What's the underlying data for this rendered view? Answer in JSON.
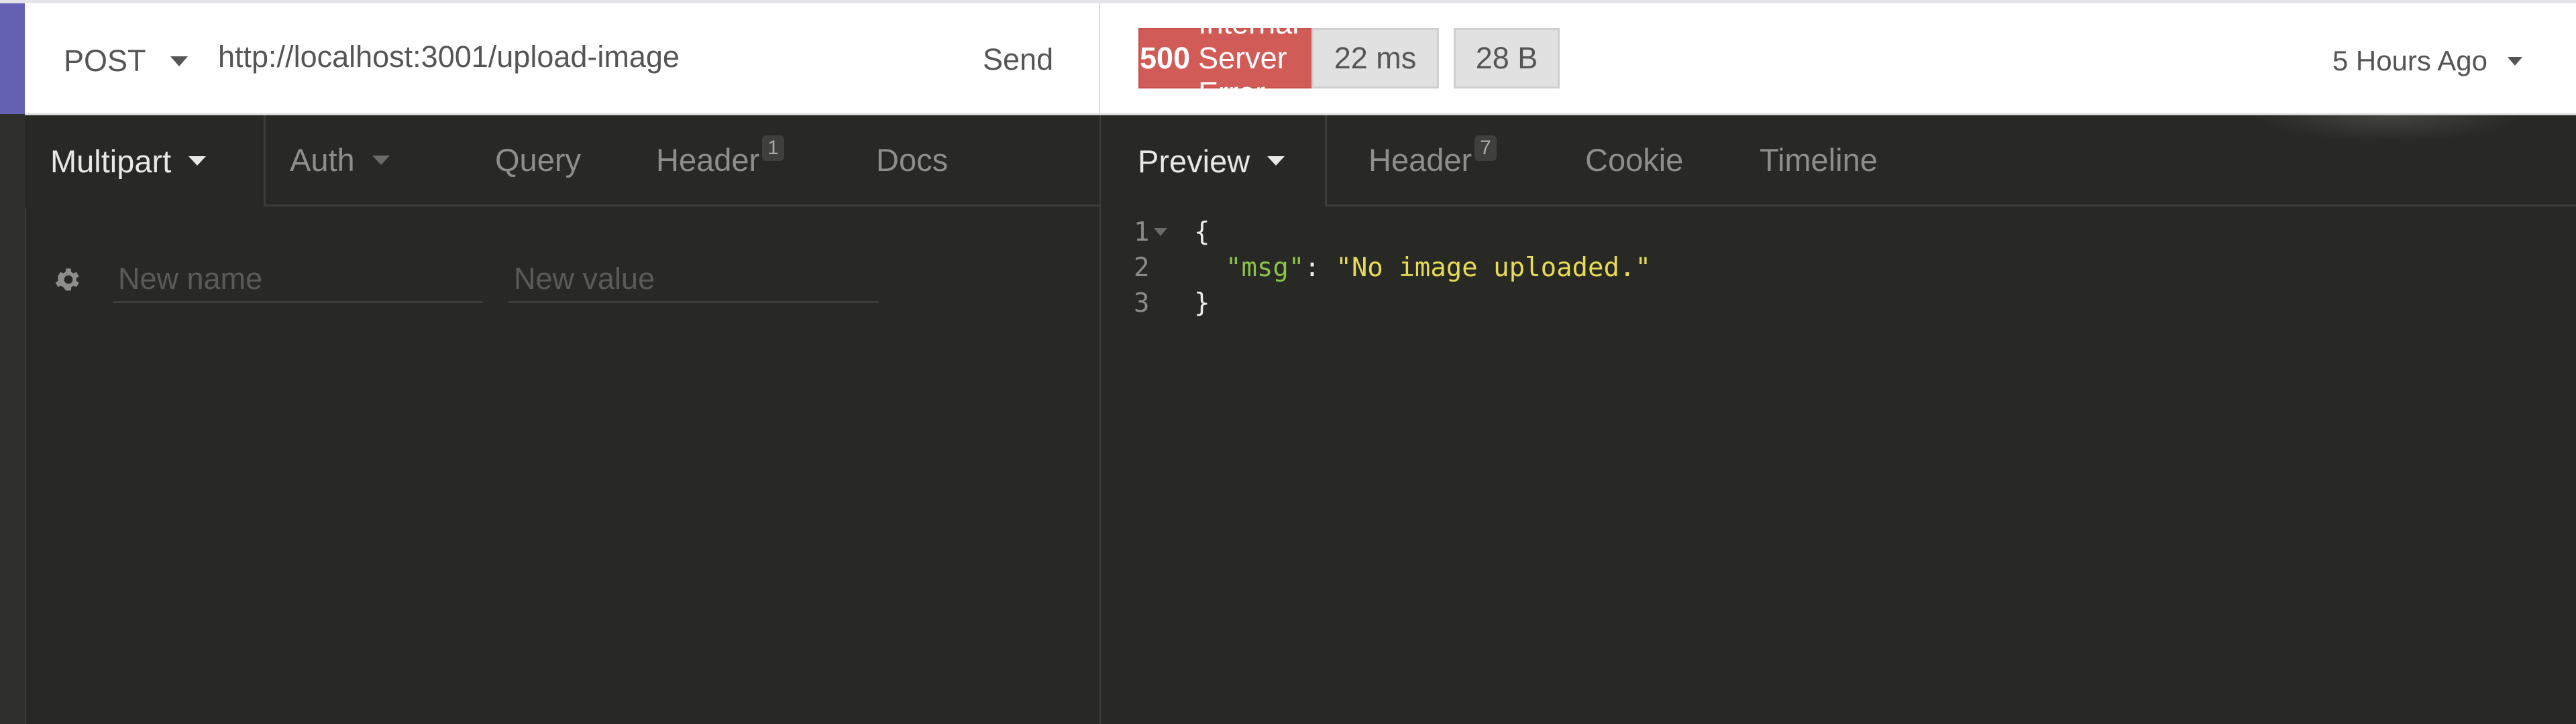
{
  "request": {
    "method": "POST",
    "url": "http://localhost:3001/upload-image",
    "send_label": "Send"
  },
  "response_meta": {
    "status_code": "500",
    "status_text": "Internal Server Error",
    "time": "22 ms",
    "size": "28 B",
    "history": "5 Hours Ago"
  },
  "request_tabs": [
    {
      "label": "Multipart",
      "active": true,
      "dropdown": true
    },
    {
      "label": "Auth",
      "dropdown": true
    },
    {
      "label": "Query"
    },
    {
      "label": "Header",
      "count": "1"
    },
    {
      "label": "Docs"
    }
  ],
  "params": {
    "name_placeholder": "New name",
    "value_placeholder": "New value"
  },
  "response_tabs": [
    {
      "label": "Preview",
      "active": true,
      "dropdown": true
    },
    {
      "label": "Header",
      "count": "7"
    },
    {
      "label": "Cookie"
    },
    {
      "label": "Timeline"
    }
  ],
  "response_body": {
    "lines": [
      {
        "n": "1",
        "text": "{"
      },
      {
        "n": "2",
        "key": "\"msg\"",
        "sep": ": ",
        "value": "\"No image uploaded.\""
      },
      {
        "n": "3",
        "text": "}"
      }
    ]
  },
  "colors": {
    "accent": "#6461b3",
    "error": "#d15c57",
    "json_key": "#8bc34a",
    "json_string": "#e6db55"
  }
}
